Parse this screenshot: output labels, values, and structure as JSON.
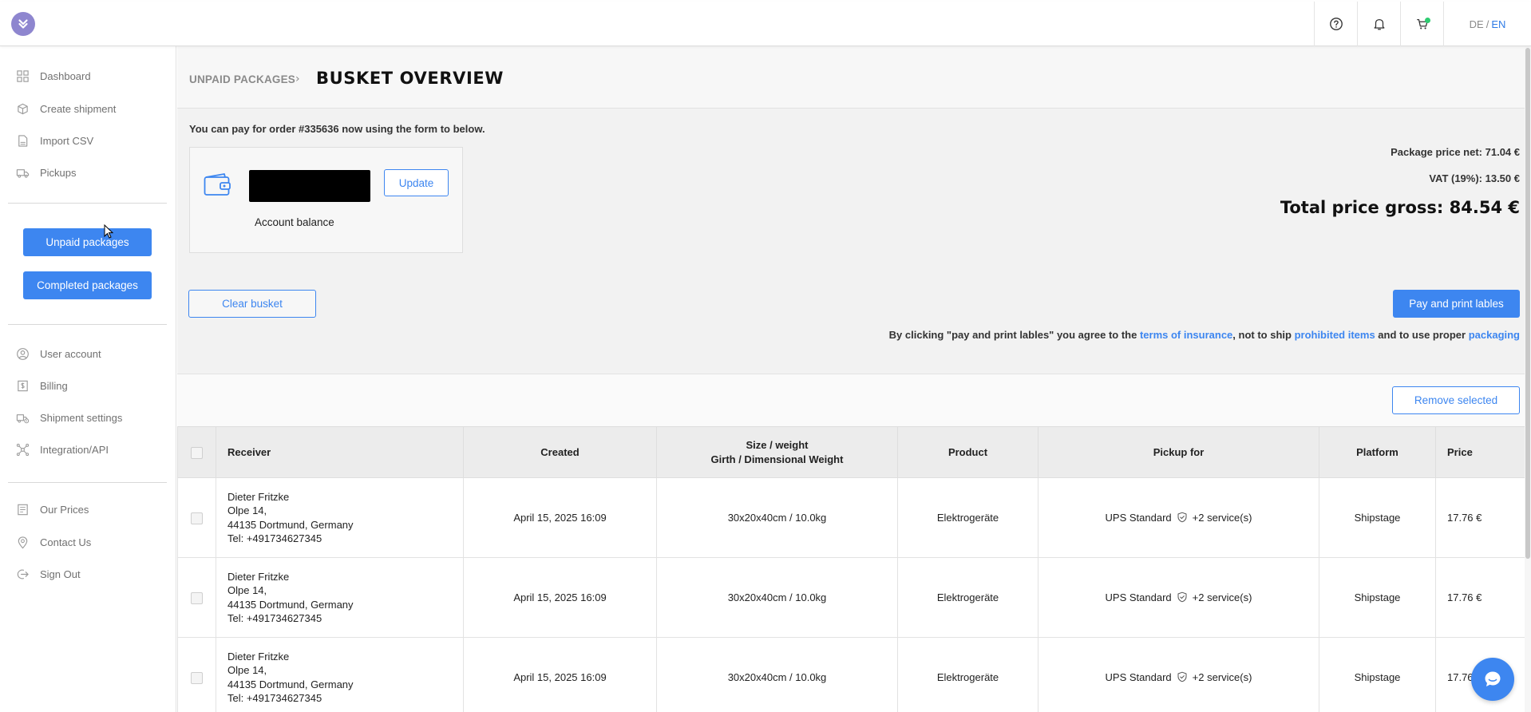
{
  "header": {
    "lang_de": "DE",
    "lang_sep": "/",
    "lang_en": "EN",
    "icons": [
      "help-icon",
      "bell-icon",
      "cart-icon"
    ],
    "cart_indicator_color": "#2ecc71"
  },
  "sidebar": {
    "nav_top": [
      {
        "label": "Dashboard",
        "icon": "dashboard-icon"
      },
      {
        "label": "Create shipment",
        "icon": "box-icon"
      },
      {
        "label": "Import CSV",
        "icon": "csv-icon"
      },
      {
        "label": "Pickups",
        "icon": "truck-icon"
      }
    ],
    "unpaid_label": "Unpaid packages",
    "completed_label": "Completed packages",
    "nav_middle": [
      {
        "label": "User account",
        "icon": "user-icon"
      },
      {
        "label": "Billing",
        "icon": "billing-icon"
      },
      {
        "label": "Shipment settings",
        "icon": "shipment-settings-icon"
      },
      {
        "label": "Integration/API",
        "icon": "integration-icon"
      }
    ],
    "nav_bottom": [
      {
        "label": "Our Prices",
        "icon": "price-tag-icon"
      },
      {
        "label": "Contact Us",
        "icon": "location-icon"
      },
      {
        "label": "Sign Out",
        "icon": "sign-out-icon"
      }
    ]
  },
  "breadcrumb": {
    "parent": "UNPAID PACKAGES",
    "current": "BUSKET OVERVIEW"
  },
  "payment": {
    "note": "You can pay for order #335636 now using the form to below.",
    "update_label": "Update",
    "balance_label": "Account balance"
  },
  "prices": {
    "net": "Package price net: 71.04 €",
    "vat": "VAT (19%): 13.50 €",
    "total": "Total price gross: 84.54 €"
  },
  "actions": {
    "clear_label": "Clear busket",
    "pay_label": "Pay and print lables",
    "remove_label": "Remove selected"
  },
  "agreement": {
    "part1": "By clicking \"pay and print lables\" you agree to the ",
    "link1": "terms of insurance",
    "part2": ", not to ship ",
    "link2": "prohibited items",
    "part3": " and to use proper ",
    "link3": "packaging"
  },
  "table": {
    "columns": {
      "receiver": "Receiver",
      "created": "Created",
      "size_line1": "Size / weight",
      "size_line2": "Girth / Dimensional Weight",
      "product": "Product",
      "pickup": "Pickup for",
      "platform": "Platform",
      "price": "Price"
    },
    "rows": [
      {
        "name": "Dieter Fritzke",
        "street": "Olpe 14,",
        "city": "44135 Dortmund, Germany",
        "tel": "Tel: +491734627345",
        "created": "April 15, 2025 16:09",
        "size": "30x20x40cm / 10.0kg",
        "product": "Elektrogeräte",
        "service": "UPS Standard",
        "extra": "+2 service(s)",
        "platform": "Shipstage",
        "price": "17.76 €"
      },
      {
        "name": "Dieter Fritzke",
        "street": "Olpe 14,",
        "city": "44135 Dortmund, Germany",
        "tel": "Tel: +491734627345",
        "created": "April 15, 2025 16:09",
        "size": "30x20x40cm / 10.0kg",
        "product": "Elektrogeräte",
        "service": "UPS Standard",
        "extra": "+2 service(s)",
        "platform": "Shipstage",
        "price": "17.76 €"
      },
      {
        "name": "Dieter Fritzke",
        "street": "Olpe 14,",
        "city": "44135 Dortmund, Germany",
        "tel": "Tel: +491734627345",
        "created": "April 15, 2025 16:09",
        "size": "30x20x40cm / 10.0kg",
        "product": "Elektrogeräte",
        "service": "UPS Standard",
        "extra": "+2 service(s)",
        "platform": "Shipstage",
        "price": "17.76"
      }
    ]
  },
  "colors": {
    "accent": "#3d86f0",
    "logo": "#8e86cf"
  }
}
